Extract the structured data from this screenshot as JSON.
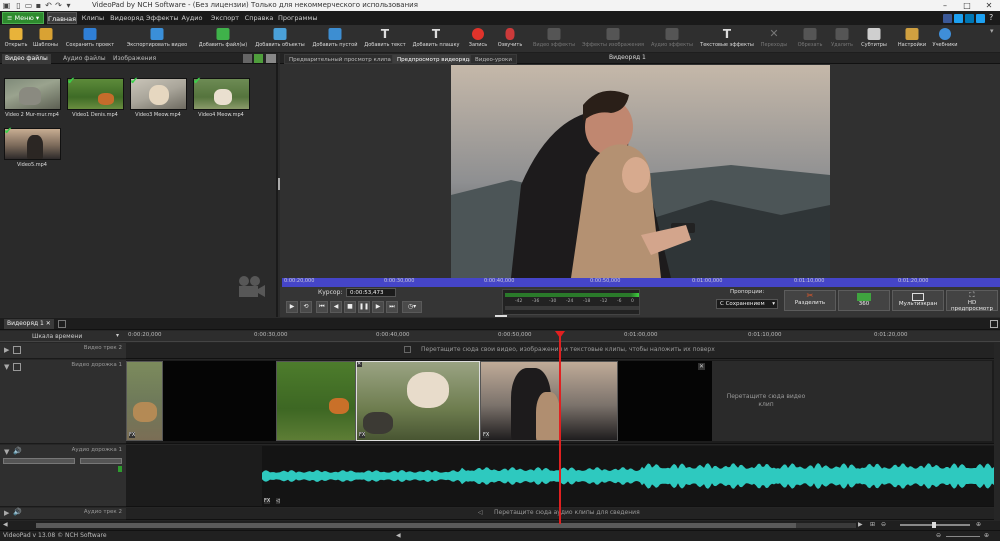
{
  "window": {
    "title": "VideoPad by NCH Software - (Без лицензии) Только для некоммерческого использования"
  },
  "menubar": {
    "menu_button": "Меню",
    "tabs": [
      "Главная",
      "Клипы",
      "Видеоряд",
      "Эффекты",
      "Аудио",
      "Экспорт",
      "Справка",
      "Программы"
    ],
    "active_tab": "Главная"
  },
  "toolbar": {
    "items": [
      {
        "label": "Открыть",
        "icon": "folder-open-icon",
        "color": "#e8b33a"
      },
      {
        "label": "Шаблоны",
        "icon": "templates-icon",
        "color": "#d9a233"
      },
      {
        "label": "Сохранить проект",
        "icon": "save-icon",
        "color": "#2f7fd6"
      },
      {
        "label": "Экспортировать видео",
        "icon": "export-video-icon",
        "color": "#3a8fd9"
      },
      {
        "label": "Добавить файл(ы)",
        "icon": "add-files-icon",
        "color": "#3fb24a"
      },
      {
        "label": "Добавить объекты",
        "icon": "add-objects-icon",
        "color": "#4aa0d8"
      },
      {
        "label": "Добавить пустой",
        "icon": "add-blank-icon",
        "color": "#3d8ed2"
      },
      {
        "label": "Добавить текст",
        "icon": "add-text-icon",
        "color": "#dddddd"
      },
      {
        "label": "Добавить плашку",
        "icon": "add-title-icon",
        "color": "#dddddd"
      },
      {
        "label": "Запись",
        "icon": "record-icon",
        "color": "#e0332b"
      },
      {
        "label": "Озвучить",
        "icon": "narrate-icon",
        "color": "#cc3a3a"
      },
      {
        "label": "Видео эффекты",
        "icon": "video-effects-icon",
        "color": "#555555",
        "disabled": true
      },
      {
        "label": "Эффекты изображения",
        "icon": "image-effects-icon",
        "color": "#555555",
        "disabled": true
      },
      {
        "label": "Аудио эффекты",
        "icon": "audio-effects-icon",
        "color": "#555555",
        "disabled": true
      },
      {
        "label": "Текстовые эффекты",
        "icon": "text-effects-icon",
        "color": "#dddddd"
      },
      {
        "label": "Переходы",
        "icon": "transitions-icon",
        "color": "#555555",
        "disabled": true
      },
      {
        "label": "Обрезать",
        "icon": "crop-icon",
        "color": "#555555",
        "disabled": true
      },
      {
        "label": "Удалить",
        "icon": "delete-icon",
        "color": "#555555",
        "disabled": true
      },
      {
        "label": "Субтитры",
        "icon": "subtitles-icon",
        "color": "#cfcfcf"
      },
      {
        "label": "Настройки",
        "icon": "settings-icon",
        "color": "#d0a040"
      },
      {
        "label": "Учебники",
        "icon": "tutorials-icon",
        "color": "#3f8ed8"
      }
    ]
  },
  "bin": {
    "tabs": [
      "Видео файлы",
      "Аудио файлы",
      "Изображения"
    ],
    "active_tab": "Видео файлы",
    "clips": [
      {
        "name": "Video 2 Mur-mur.mp4",
        "checked": false
      },
      {
        "name": "Video1 Denis.mp4",
        "checked": true
      },
      {
        "name": "Video3 Meow.mp4",
        "checked": true
      },
      {
        "name": "Video4 Meow.mp4",
        "checked": true
      },
      {
        "name": "Video5.mp4",
        "checked": true
      }
    ]
  },
  "preview": {
    "tabs": [
      "Предварительный просмотр клипа",
      "Предпросмотр видеоряда",
      "Видео-уроки"
    ],
    "active_tab": "Предпросмотр видеоряда",
    "panel_title": "Видеоряд 1",
    "ruler_ticks": [
      "0:00:20,000",
      "0:00:30,000",
      "0:00:40,000",
      "0:00:50,000",
      "0:01:00,000",
      "0:01:10,000",
      "0:01:20,000"
    ],
    "cursor_label": "Курсор:",
    "cursor_value": "0:00:53,473",
    "db_ticks": [
      "-42",
      "-36",
      "-30",
      "-24",
      "-18",
      "-12",
      "-6",
      "0"
    ],
    "aspect_label": "Пропорции:",
    "aspect_value": "С Сохранением",
    "buttons": [
      "Разделить",
      "360",
      "Мультиэкран",
      "HD предпросмотр"
    ]
  },
  "timeline": {
    "tab": "Видеоряд 1",
    "scale_label": "Шкала времени",
    "ruler_ticks": [
      "0:00:20,000",
      "0:00:30,000",
      "0:00:40,000",
      "0:00:50,000",
      "0:01:00,000",
      "0:01:10,000",
      "0:01:20,000"
    ],
    "tracks": {
      "video2": "Видео трек 2",
      "video1": "Видео дорожка 1",
      "audio1": "Аудио дорожка 1",
      "audio2": "Аудио трек 2"
    },
    "overlay_hint": "Перетащите сюда свои видео, изображения и текстовые клипы, чтобы наложить их поверх",
    "video_hint": "Перетащите сюда видео клип",
    "audio_hint": "Перетащите сюда аудио клипы для сведения",
    "waveform_color": "#2ec9bf",
    "playhead_color": "#e02020"
  },
  "status": {
    "text": "VideoPad v 13.08 © NCH Software"
  }
}
